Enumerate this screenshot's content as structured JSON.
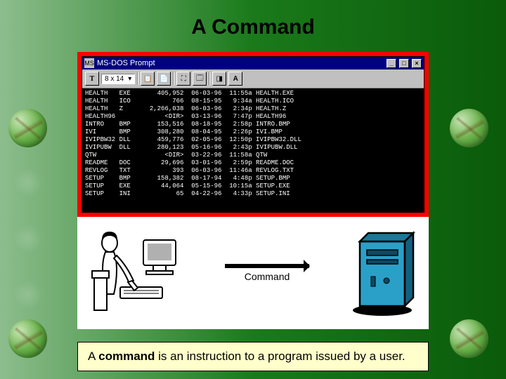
{
  "slide": {
    "title": "A Command",
    "arrow_label": "Command",
    "definition_prefix": "A ",
    "definition_bold": "command",
    "definition_suffix": " is an instruction to a program issued by a user."
  },
  "dos": {
    "window_title": "MS-DOS Prompt",
    "font_size_label": "8 x 14",
    "toolbar_icons": [
      "copy-icon",
      "paste-icon",
      "fullscreen-icon",
      "properties-icon",
      "background-icon",
      "font-a-icon"
    ],
    "listing": [
      {
        "name": "HEALTH",
        "ext": "EXE",
        "size": "405,952",
        "date": "06-03-96",
        "time": "11:55a",
        "file": "HEALTH.EXE"
      },
      {
        "name": "HEALTH",
        "ext": "ICO",
        "size": "766",
        "date": "08-15-95",
        "time": "9:34a",
        "file": "HEALTH.ICO"
      },
      {
        "name": "HEALTH",
        "ext": "Z",
        "size": "2,266,038",
        "date": "06-03-96",
        "time": "2:34p",
        "file": "HEALTH.Z"
      },
      {
        "name": "HEALTH96",
        "ext": "",
        "size": "<DIR>",
        "date": "03-13-96",
        "time": "7:47p",
        "file": "HEALTH96"
      },
      {
        "name": "INTRO",
        "ext": "BMP",
        "size": "153,516",
        "date": "08-18-95",
        "time": "2:58p",
        "file": "INTRO.BMP"
      },
      {
        "name": "IVI",
        "ext": "BMP",
        "size": "308,280",
        "date": "08-04-95",
        "time": "2:26p",
        "file": "IVI.BMP"
      },
      {
        "name": "IVIPBW32",
        "ext": "DLL",
        "size": "459,776",
        "date": "02-05-96",
        "time": "12:50p",
        "file": "IVIPBW32.DLL"
      },
      {
        "name": "IVIPUBW",
        "ext": "DLL",
        "size": "280,123",
        "date": "05-16-96",
        "time": "2:43p",
        "file": "IVIPUBW.DLL"
      },
      {
        "name": "QTW",
        "ext": "",
        "size": "<DIR>",
        "date": "03-22-96",
        "time": "11:58a",
        "file": "QTW"
      },
      {
        "name": "README",
        "ext": "DOC",
        "size": "29,696",
        "date": "03-01-96",
        "time": "2:59p",
        "file": "README.DOC"
      },
      {
        "name": "REVLOG",
        "ext": "TXT",
        "size": "393",
        "date": "06-03-96",
        "time": "11:46a",
        "file": "REVLOG.TXT"
      },
      {
        "name": "SETUP",
        "ext": "BMP",
        "size": "158,382",
        "date": "08-17-94",
        "time": "4:48p",
        "file": "SETUP.BMP"
      },
      {
        "name": "SETUP",
        "ext": "EXE",
        "size": "44,064",
        "date": "05-15-96",
        "time": "10:15a",
        "file": "SETUP.EXE"
      },
      {
        "name": "SETUP",
        "ext": "INI",
        "size": "65",
        "date": "04-22-96",
        "time": "4:33p",
        "file": "SETUP.INI"
      }
    ]
  }
}
